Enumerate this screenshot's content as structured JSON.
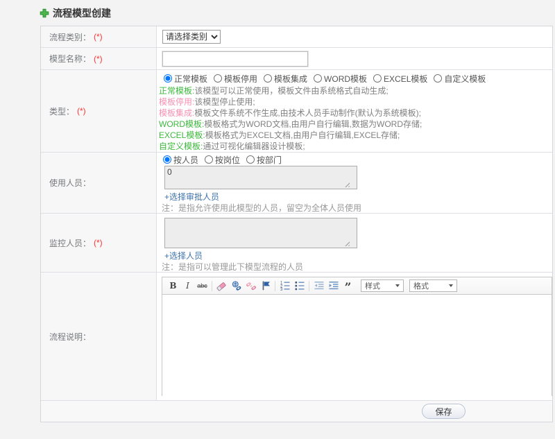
{
  "title": "流程模型创建",
  "rows": {
    "category": {
      "label": "流程类别：",
      "required": "(*)",
      "select_value": "请选择类别"
    },
    "name": {
      "label": "模型名称：",
      "required": "(*)",
      "input_value": ""
    },
    "type": {
      "label": "类型：",
      "required": "(*)",
      "options": [
        "正常模板",
        "模板停用",
        "模板集成",
        "WORD模板",
        "EXCEL模板",
        "自定义模板"
      ],
      "selected_option": "正常模板",
      "descriptions": [
        {
          "term": "正常模板:",
          "text": "该模型可以正常使用，模板文件由系统格式自动生成;"
        },
        {
          "term": "模板停用:",
          "text": "该模型停止使用;"
        },
        {
          "term": "模板集成:",
          "text": "模板文件系统不作生成,由技术人员手动制作(默认为系统模板);"
        },
        {
          "term": "WORD模板:",
          "text": "模板格式为WORD文档,由用户自行编辑,数据为WORD存储;"
        },
        {
          "term": "EXCEL模板:",
          "text": "模板格式为EXCEL文档,由用户自行编辑,EXCEL存储;"
        },
        {
          "term": "自定义模板:",
          "text": "通过可视化编辑器设计模板;"
        }
      ]
    },
    "users": {
      "label": "使用人员：",
      "options": [
        "按人员",
        "按岗位",
        "按部门"
      ],
      "selected_option": "按人员",
      "textarea_value": "0",
      "link": "+选择审批人员",
      "note": "注：是指允许使用此模型的人员，留空为全体人员使用"
    },
    "monitor": {
      "label": "监控人员：",
      "required": "(*)",
      "textarea_value": "",
      "link": "+选择人员",
      "note": "注：是指可以管理此下模型流程的人员"
    },
    "description": {
      "label": "流程说明：",
      "toolbar": {
        "bold": "B",
        "italic": "I",
        "strike": "abc",
        "quote": "”",
        "styles_dropdown": "样式",
        "format_dropdown": "格式"
      }
    }
  },
  "save_button": "保存",
  "colors": {
    "accent_green": "#3cb83c",
    "term_pink": "#f591b2",
    "link_blue": "#3d73ad",
    "required_red": "#ff3333",
    "note_gray": "#999999",
    "toolbar_icon_blue": "#2f62a6",
    "toolbar_icon_pink": "#ef9ab5"
  }
}
